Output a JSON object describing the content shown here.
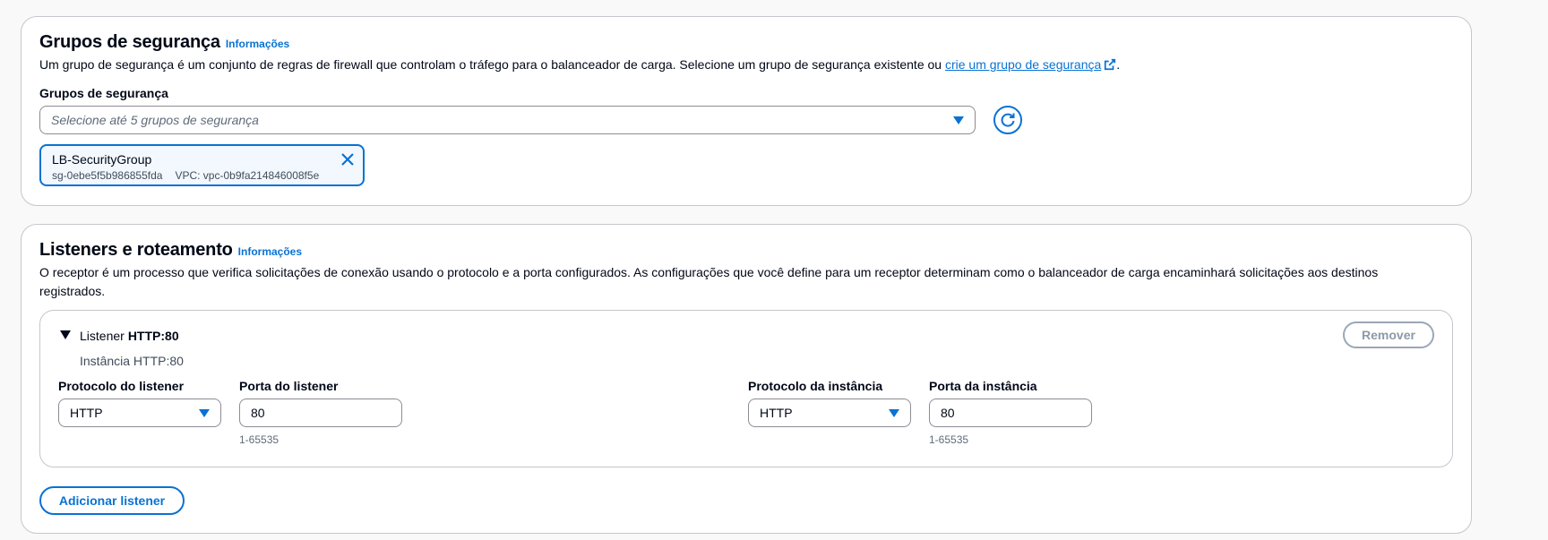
{
  "security_groups": {
    "title": "Grupos de segurança",
    "info_link": "Informações",
    "description_prefix": "Um grupo de segurança é um conjunto de regras de firewall que controlam o tráfego para o balanceador de carga. Selecione um grupo de segurança existente ou ",
    "description_link": "crie um grupo de segurança",
    "description_suffix": ".",
    "field_label": "Grupos de segurança",
    "select_placeholder": "Selecione até 5 grupos de segurança",
    "selected_token": {
      "name": "LB-SecurityGroup",
      "id": "sg-0ebe5f5b986855fda",
      "vpc": "VPC: vpc-0b9fa214846008f5e"
    }
  },
  "listeners": {
    "title": "Listeners e roteamento",
    "info_link": "Informações",
    "description": "O receptor é um processo que verifica solicitações de conexão usando o protocolo e a porta configurados. As configurações que você define para um receptor determinam como o balanceador de carga encaminhará solicitações aos destinos registrados.",
    "listener": {
      "title_prefix": "Listener",
      "title_value": "HTTP:80",
      "subtitle": "Instância HTTP:80",
      "remove_button": "Remover",
      "listener_protocol_label": "Protocolo do listener",
      "listener_protocol_value": "HTTP",
      "listener_port_label": "Porta do listener",
      "listener_port_value": "80",
      "listener_port_constraint": "1-65535",
      "instance_protocol_label": "Protocolo da instância",
      "instance_protocol_value": "HTTP",
      "instance_port_label": "Porta da instância",
      "instance_port_value": "80",
      "instance_port_constraint": "1-65535"
    },
    "add_button": "Adicionar listener"
  },
  "colors": {
    "accent": "#0972d3",
    "border": "#c6c6cd",
    "text": "#000716",
    "token_bg": "#f2f8fd"
  }
}
